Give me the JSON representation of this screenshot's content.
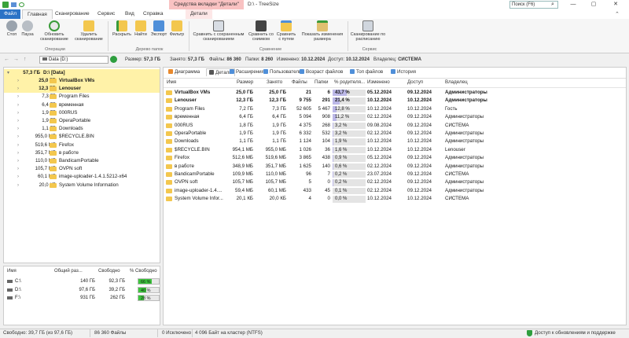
{
  "window": {
    "context_tab": "Средства вкладки \"Детали\"",
    "title": "D:\\ - TreeSize",
    "search_placeholder": "Поиск (F6)",
    "controls": [
      "—",
      "▢",
      "✕"
    ]
  },
  "ribbon": {
    "tabs": [
      "Файл",
      "Главная",
      "Сканирование",
      "Сервис",
      "Вид",
      "Справка",
      "Детали"
    ],
    "buttons": [
      {
        "label": "Стоп",
        "icon": "stop-icon"
      },
      {
        "label": "Пауза",
        "icon": "pause-icon"
      },
      {
        "label": "Обновить сканирование",
        "icon": "refresh-icon"
      },
      {
        "label": "Удалить сканирование",
        "icon": "delete-scan-icon"
      },
      {
        "label": "Раскрыть",
        "icon": "expand-icon"
      },
      {
        "label": "Найти",
        "icon": "find-icon"
      },
      {
        "label": "Экспорт",
        "icon": "export-icon"
      },
      {
        "label": "Фильтр",
        "icon": "filter-icon"
      },
      {
        "label": "Сравнить с сохраненным сканированием",
        "icon": "compare-saved-icon"
      },
      {
        "label": "Сравнить со снимком",
        "icon": "compare-snapshot-icon"
      },
      {
        "label": "Сравнить с путем",
        "icon": "compare-path-icon"
      },
      {
        "label": "Показать изменения размера",
        "icon": "show-changes-icon"
      },
      {
        "label": "Сканирование по расписанию",
        "icon": "schedule-icon"
      }
    ],
    "groups": [
      "Операции",
      "Дерево папок",
      "Сравнение",
      "Сервис"
    ]
  },
  "nav": {
    "path": "Data (D:)",
    "size_label": "Размер:",
    "size": "57,3 ГБ",
    "alloc_label": "Занято:",
    "alloc": "57,3 ГБ",
    "files_label": "Файлы:",
    "files": "86 360",
    "folders_label": "Папки:",
    "folders": "8 260",
    "modified_label": "Изменено:",
    "modified": "10.12.2024",
    "access_label": "Доступ:",
    "access": "10.12.2024",
    "owner_label": "Владелец:",
    "owner": "СИСТЕМА"
  },
  "tree": {
    "root_size": "57,3 ГБ",
    "root_label": "D:\\  [Data]",
    "items": [
      {
        "size": "25,0 ГБ",
        "name": "VirtualBox VMs",
        "bold": true
      },
      {
        "size": "12,3 ГБ",
        "name": "Lenouser",
        "bold": true
      },
      {
        "size": "7,3 ГБ",
        "name": "Program Files"
      },
      {
        "size": "6,4 ГБ",
        "name": "временная"
      },
      {
        "size": "1,9 ГБ",
        "name": "000RUS"
      },
      {
        "size": "1,9 ГБ",
        "name": "OperaPortable"
      },
      {
        "size": "1,1 ГБ",
        "name": "Downloads"
      },
      {
        "size": "955,0 МБ",
        "name": "$RECYCLE.BIN"
      },
      {
        "size": "519,6 МБ",
        "name": "Firefox"
      },
      {
        "size": "351,7 МБ",
        "name": "в работе"
      },
      {
        "size": "110,0 МБ",
        "name": "BandicamPortable"
      },
      {
        "size": "105,7 МБ",
        "name": "OVPN soft"
      },
      {
        "size": "60,1 МБ",
        "name": "image-uploader-1.4.1.5212-x64"
      },
      {
        "size": "20,0 КБ",
        "name": "System Volume Information"
      }
    ]
  },
  "drives": {
    "headers": [
      "Имя",
      "Общий раз...",
      "Свободно",
      "% Свободно"
    ],
    "rows": [
      {
        "name": "C:\\",
        "total": "140 ГБ",
        "free": "92,3 ГБ",
        "pct": "66 %",
        "pct_value": 66
      },
      {
        "name": "D:\\",
        "total": "97,6 ГБ",
        "free": "39,2 ГБ",
        "pct": "40 %",
        "pct_value": 40
      },
      {
        "name": "F:\\",
        "total": "931 ГБ",
        "free": "262 ГБ",
        "pct": "28 %",
        "pct_value": 28
      }
    ]
  },
  "view_tabs": [
    "Диаграмма",
    "Детали",
    "Расширения",
    "Пользователи",
    "Возраст файлов",
    "Топ файлов",
    "История"
  ],
  "details": {
    "headers": [
      "Имя",
      "Размер",
      "Занято",
      "Файлы",
      "Папки",
      "% родителя...",
      "Изменено",
      "Доступ",
      "Владелец"
    ],
    "rows": [
      {
        "name": "VirtualBox VMs",
        "size": "25,0 ГБ",
        "alloc": "25,0 ГБ",
        "files": "21",
        "folders": "6",
        "pct": "43,7 %",
        "pct_value": 43.7,
        "modified": "05.12.2024",
        "access": "09.12.2024",
        "owner": "Администраторы",
        "bold": true
      },
      {
        "name": "Lenouser",
        "size": "12,3 ГБ",
        "alloc": "12,3 ГБ",
        "files": "9 755",
        "folders": "291",
        "pct": "21,4 %",
        "pct_value": 21.4,
        "modified": "10.12.2024",
        "access": "10.12.2024",
        "owner": "Администраторы",
        "bold": true
      },
      {
        "name": "Program Files",
        "size": "7,2 ГБ",
        "alloc": "7,3 ГБ",
        "files": "52 605",
        "folders": "5 467",
        "pct": "12,8 %",
        "pct_value": 12.8,
        "modified": "10.12.2024",
        "access": "10.12.2024",
        "owner": "Гость"
      },
      {
        "name": "временная",
        "size": "6,4 ГБ",
        "alloc": "6,4 ГБ",
        "files": "5 094",
        "folders": "908",
        "pct": "11,2 %",
        "pct_value": 11.2,
        "modified": "02.12.2024",
        "access": "09.12.2024",
        "owner": "Администраторы"
      },
      {
        "name": "000RUS",
        "size": "1,8 ГБ",
        "alloc": "1,9 ГБ",
        "files": "4 375",
        "folders": "268",
        "pct": "3,2 %",
        "pct_value": 3.2,
        "modified": "09.08.2024",
        "access": "09.12.2024",
        "owner": "СИСТЕМА"
      },
      {
        "name": "OperaPortable",
        "size": "1,9 ГБ",
        "alloc": "1,9 ГБ",
        "files": "6 332",
        "folders": "532",
        "pct": "3,2 %",
        "pct_value": 3.2,
        "modified": "02.12.2024",
        "access": "09.12.2024",
        "owner": "Администраторы"
      },
      {
        "name": "Downloads",
        "size": "1,1 ГБ",
        "alloc": "1,1 ГБ",
        "files": "1 124",
        "folders": "104",
        "pct": "1,9 %",
        "pct_value": 1.9,
        "modified": "10.12.2024",
        "access": "10.12.2024",
        "owner": "Администраторы"
      },
      {
        "name": "$RECYCLE.BIN",
        "size": "954,1 МБ",
        "alloc": "955,0 МБ",
        "files": "1 026",
        "folders": "36",
        "pct": "1,6 %",
        "pct_value": 1.6,
        "modified": "10.12.2024",
        "access": "10.12.2024",
        "owner": "Lenouser"
      },
      {
        "name": "Firefox",
        "size": "512,6 МБ",
        "alloc": "519,6 МБ",
        "files": "3 865",
        "folders": "438",
        "pct": "0,9 %",
        "pct_value": 0.9,
        "modified": "05.12.2024",
        "access": "09.12.2024",
        "owner": "Администраторы"
      },
      {
        "name": "в работе",
        "size": "348,9 МБ",
        "alloc": "351,7 МБ",
        "files": "1 625",
        "folders": "140",
        "pct": "0,6 %",
        "pct_value": 0.6,
        "modified": "02.12.2024",
        "access": "09.12.2024",
        "owner": "Администраторы"
      },
      {
        "name": "BandicamPortable",
        "size": "109,9 МБ",
        "alloc": "110,0 МБ",
        "files": "96",
        "folders": "7",
        "pct": "0,2 %",
        "pct_value": 0.2,
        "modified": "23.07.2024",
        "access": "09.12.2024",
        "owner": "СИСТЕМА"
      },
      {
        "name": "OVPN soft",
        "size": "105,7 МБ",
        "alloc": "105,7 МБ",
        "files": "5",
        "folders": "0",
        "pct": "0,2 %",
        "pct_value": 0.2,
        "modified": "02.12.2024",
        "access": "09.12.2024",
        "owner": "Администраторы"
      },
      {
        "name": "image-uploader-1.4....",
        "size": "59,4 МБ",
        "alloc": "60,1 МБ",
        "files": "433",
        "folders": "45",
        "pct": "0,1 %",
        "pct_value": 0.1,
        "modified": "02.12.2024",
        "access": "09.12.2024",
        "owner": "Администраторы"
      },
      {
        "name": "System Volume Infor...",
        "size": "20,1 КБ",
        "alloc": "20,0 КБ",
        "files": "4",
        "folders": "0",
        "pct": "0,0 %",
        "pct_value": 0.0,
        "modified": "10.12.2024",
        "access": "10.12.2024",
        "owner": "СИСТЕМА"
      }
    ]
  },
  "status": {
    "free": "Свободно: 39,7 ГБ  (из 97,6 ГБ)",
    "files": "86 360 Файлы",
    "excluded": "0 Исключено",
    "cluster": "4 096 Байт на кластер (NTFS)",
    "update": "Доступ к обновлениям и поддержке"
  },
  "colors": {
    "accent": "#2b73c6",
    "tree_highlight": "#fff2a8",
    "pct_bar": "#bcb8e8",
    "drive_bar": "#3cc43c"
  }
}
